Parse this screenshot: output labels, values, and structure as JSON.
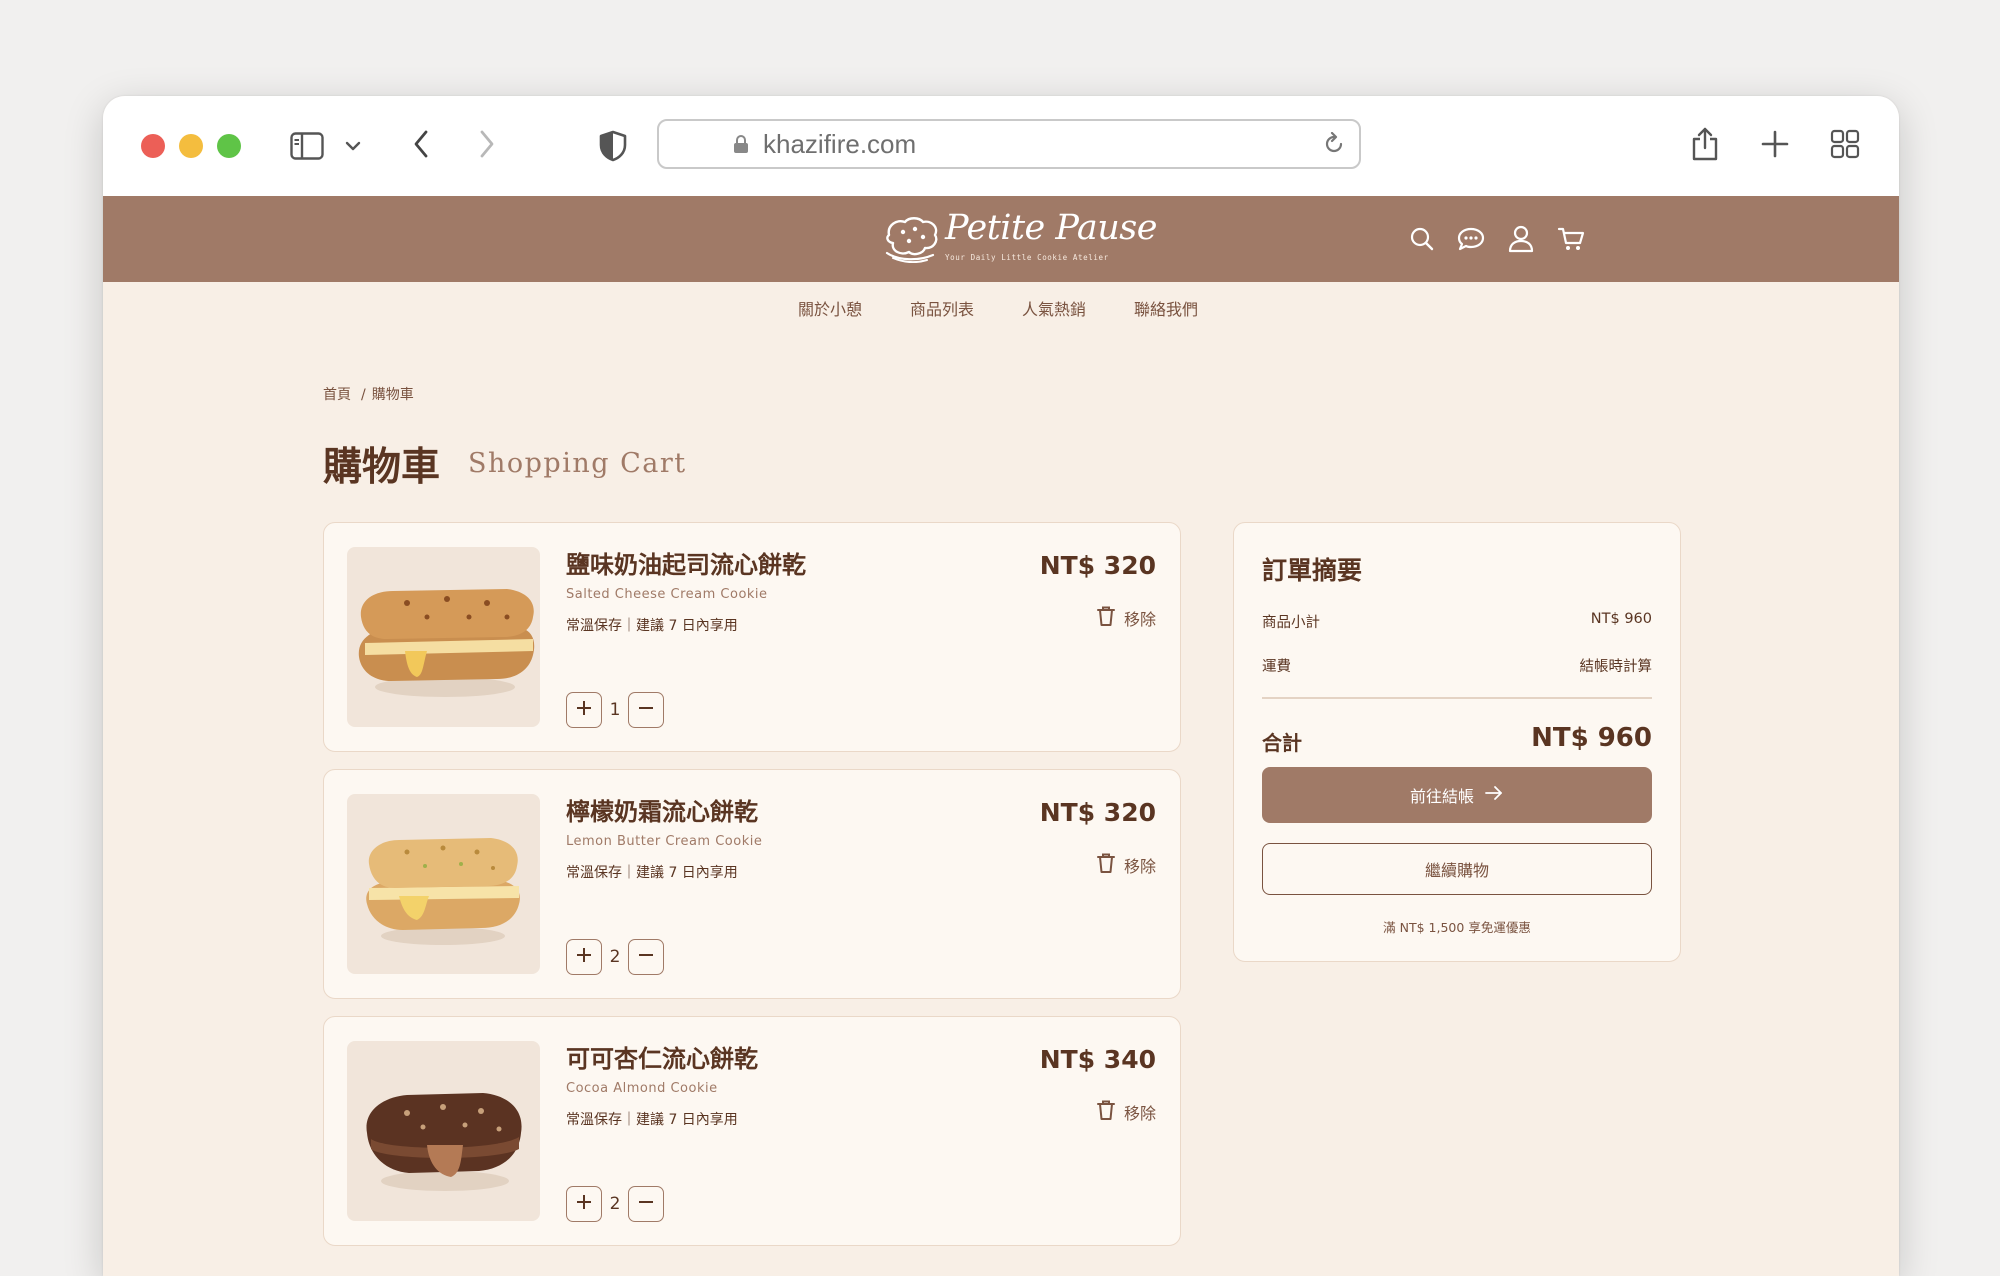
{
  "browser": {
    "url": "khazifire.com"
  },
  "site": {
    "brand": "Petite Pause",
    "tagline": "Your Daily Little Cookie Atelier"
  },
  "nav": {
    "items": [
      "關於小憩",
      "商品列表",
      "人氣熱銷",
      "聯絡我們"
    ]
  },
  "breadcrumb": {
    "home": "首頁",
    "separator": "/",
    "current": "購物車"
  },
  "page": {
    "title": "購物車",
    "subtitle": "Shopping Cart"
  },
  "cart": {
    "remove_label": "移除",
    "items": [
      {
        "name": "鹽味奶油起司流心餅乾",
        "name_en": "Salted Cheese Cream Cookie",
        "note": "常溫保存｜建議 7 日內享用",
        "price": "NT$ 320",
        "qty": "1"
      },
      {
        "name": "檸檬奶霜流心餅乾",
        "name_en": "Lemon Butter Cream Cookie",
        "note": "常溫保存｜建議 7 日內享用",
        "price": "NT$ 320",
        "qty": "2"
      },
      {
        "name": "可可杏仁流心餅乾",
        "name_en": "Cocoa Almond Cookie",
        "note": "常溫保存｜建議 7 日內享用",
        "price": "NT$ 340",
        "qty": "2"
      }
    ]
  },
  "summary": {
    "title": "訂單摘要",
    "subtotal_label": "商品小計",
    "subtotal_value": "NT$ 960",
    "shipping_label": "運費",
    "shipping_value": "結帳時計算",
    "total_label": "合計",
    "total_value": "NT$ 960",
    "checkout_label": "前往結帳",
    "continue_label": "繼續購物",
    "promo_text": "滿 NT$ 1,500 享免運優惠"
  },
  "colors": {
    "header_bg": "#a07a67",
    "page_bg": "#f8efe6",
    "card_bg": "#fdf8f2",
    "text_dark": "#5a3522",
    "accent": "#a07a67"
  },
  "icons": [
    "sidebar-icon",
    "chevron-down-icon",
    "back-icon",
    "forward-icon",
    "shield-icon",
    "lock-icon",
    "reload-icon",
    "share-icon",
    "new-tab-icon",
    "tab-overview-icon",
    "search-icon",
    "chat-icon",
    "user-icon",
    "cart-icon",
    "trash-icon",
    "plus-icon",
    "minus-icon",
    "arrow-right-icon"
  ]
}
